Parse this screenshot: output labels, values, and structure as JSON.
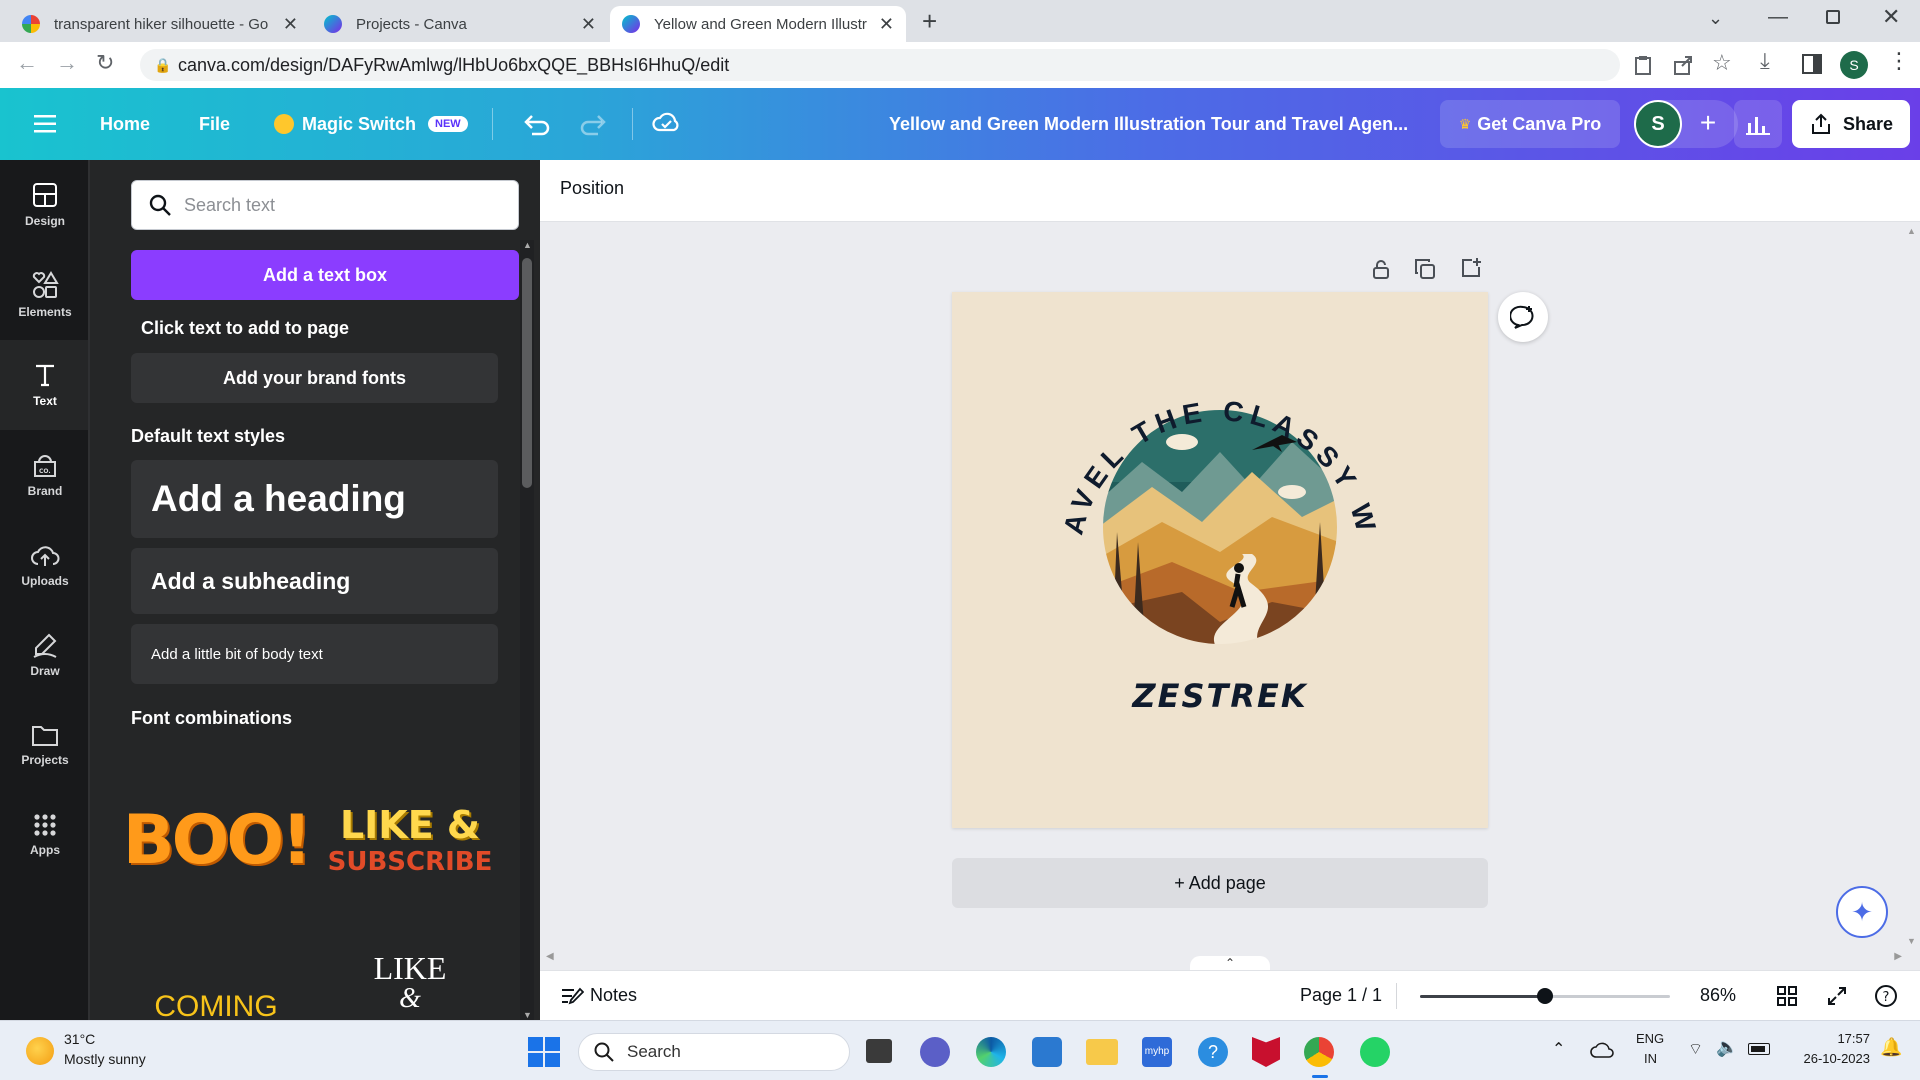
{
  "browser": {
    "tabs": [
      {
        "title": "transparent hiker silhouette - Go",
        "active": false
      },
      {
        "title": "Projects - Canva",
        "active": false
      },
      {
        "title": "Yellow and Green Modern Illustr",
        "active": true
      }
    ],
    "url": "canva.com/design/DAFyRwAmlwg/lHbUo6bxQQE_BBHsI6HhuQ/edit",
    "profile_initial": "S"
  },
  "header": {
    "home": "Home",
    "file": "File",
    "magic_switch": "Magic Switch",
    "new_badge": "NEW",
    "design_title": "Yellow and Green Modern Illustration Tour and Travel Agen...",
    "get_pro": "Get Canva Pro",
    "avatar_initial": "S",
    "share": "Share"
  },
  "rail": {
    "items": [
      {
        "label": "Design",
        "icon": "layout-icon"
      },
      {
        "label": "Elements",
        "icon": "shapes-icon"
      },
      {
        "label": "Text",
        "icon": "text-icon"
      },
      {
        "label": "Brand",
        "icon": "brand-icon"
      },
      {
        "label": "Uploads",
        "icon": "cloud-upload-icon"
      },
      {
        "label": "Draw",
        "icon": "pen-icon"
      },
      {
        "label": "Projects",
        "icon": "folder-icon"
      },
      {
        "label": "Apps",
        "icon": "grid-icon"
      }
    ]
  },
  "panel": {
    "search_placeholder": "Search text",
    "add_text_box": "Add a text box",
    "click_text": "Click text to add to page",
    "brand_fonts": "Add your brand fonts",
    "default_styles_heading": "Default text styles",
    "heading": "Add a heading",
    "subheading": "Add a subheading",
    "body": "Add a little bit of body text",
    "font_combinations": "Font combinations",
    "combos": [
      "BOO!",
      "LIKE &",
      "SUBSCRIBE",
      "COMING",
      "LIKE",
      "&"
    ]
  },
  "workspace": {
    "toolbar_position": "Position",
    "design_arc_text": "TRAVEL THE CLASSY WAY",
    "brand_name": "ZESTREK",
    "add_page": "+ Add page",
    "notes": "Notes",
    "page_indicator": "Page 1 / 1",
    "zoom": "86%",
    "zoom_fraction": 0.5
  },
  "colors": {
    "accent_purple": "#8b3dff",
    "canvas_bg": "#efe3cf",
    "text_dark": "#0f1b2d"
  },
  "taskbar": {
    "weather_temp": "31°C",
    "weather_desc": "Mostly sunny",
    "search": "Search",
    "lang_top": "ENG",
    "lang_bottom": "IN",
    "time": "17:57",
    "date": "26-10-2023"
  }
}
